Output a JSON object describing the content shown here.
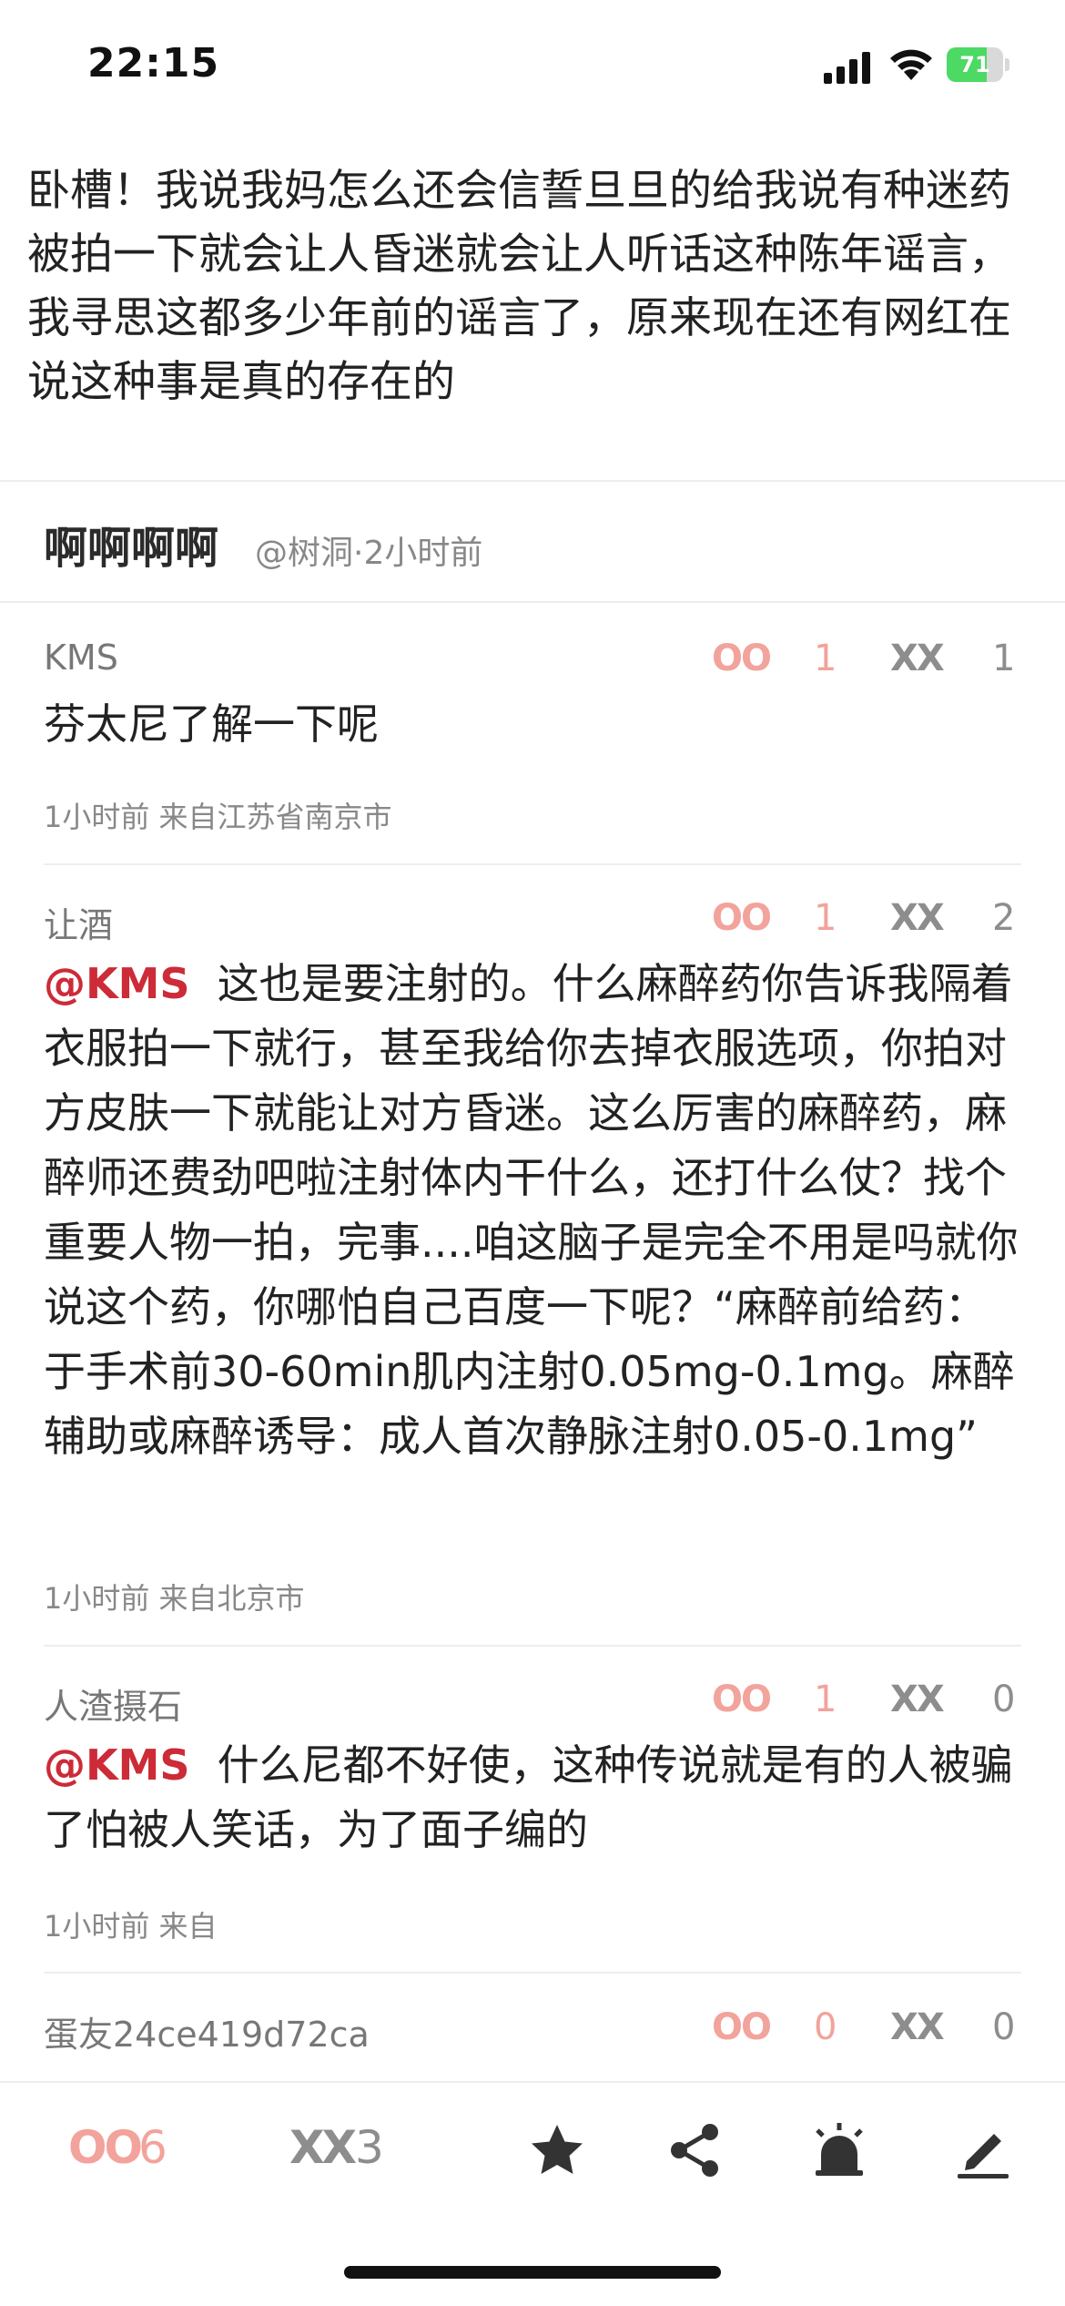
{
  "status_bar": {
    "time": "22:15",
    "battery": "71",
    "battery_level": 0.71
  },
  "post": {
    "text": "卧槽！我说我妈怎么还会信誓旦旦的给我说有种迷药被拍一下就会让人昏迷就会让人听话这种陈年谣言，我寻思这都多少年前的谣言了，原来现在还有网红在说这种事是真的存在的",
    "author": "啊啊啊啊",
    "meta": "@树洞·2小时前"
  },
  "vote_labels": {
    "up": "OO",
    "down": "XX"
  },
  "comments": [
    {
      "name": "KMS",
      "oo": "1",
      "xx": "1",
      "mention": "",
      "body": "芬太尼了解一下呢",
      "meta": "1小时前 来自江苏省南京市"
    },
    {
      "name": "让酒",
      "oo": "1",
      "xx": "2",
      "mention": "@KMS",
      "body": "这也是要注射的。什么麻醉药你告诉我隔着衣服拍一下就行，甚至我给你去掉衣服选项，你拍对方皮肤一下就能让对方昏迷。这么厉害的麻醉药，麻醉师还费劲吧啦注射体内干什么，还打什么仗？找个重要人物一拍，完事....咱这脑子是完全不用是吗就你说这个药，你哪怕自己百度一下呢？“麻醉前给药：于手术前30-60min肌内注射0.05mg-0.1mg。麻醉辅助或麻醉诱导：成人首次静脉注射0.05-0.1mg”",
      "meta": "1小时前 来自北京市"
    },
    {
      "name": "人渣摄石",
      "oo": "1",
      "xx": "0",
      "mention": "@KMS",
      "body": "什么尼都不好使，这种传说就是有的人被骗了怕被人笑话，为了面子编的",
      "meta": "1小时前 来自"
    },
    {
      "name": "蛋友24ce419d72ca",
      "oo": "0",
      "xx": "0",
      "mention": "",
      "body": "",
      "meta": ""
    }
  ],
  "bottom_bar": {
    "oo_label": "OO",
    "oo_count": "6",
    "xx_label": "XX",
    "xx_count": "3",
    "icons": [
      "star-icon",
      "share-icon",
      "alarm-icon",
      "pencil-icon"
    ]
  }
}
